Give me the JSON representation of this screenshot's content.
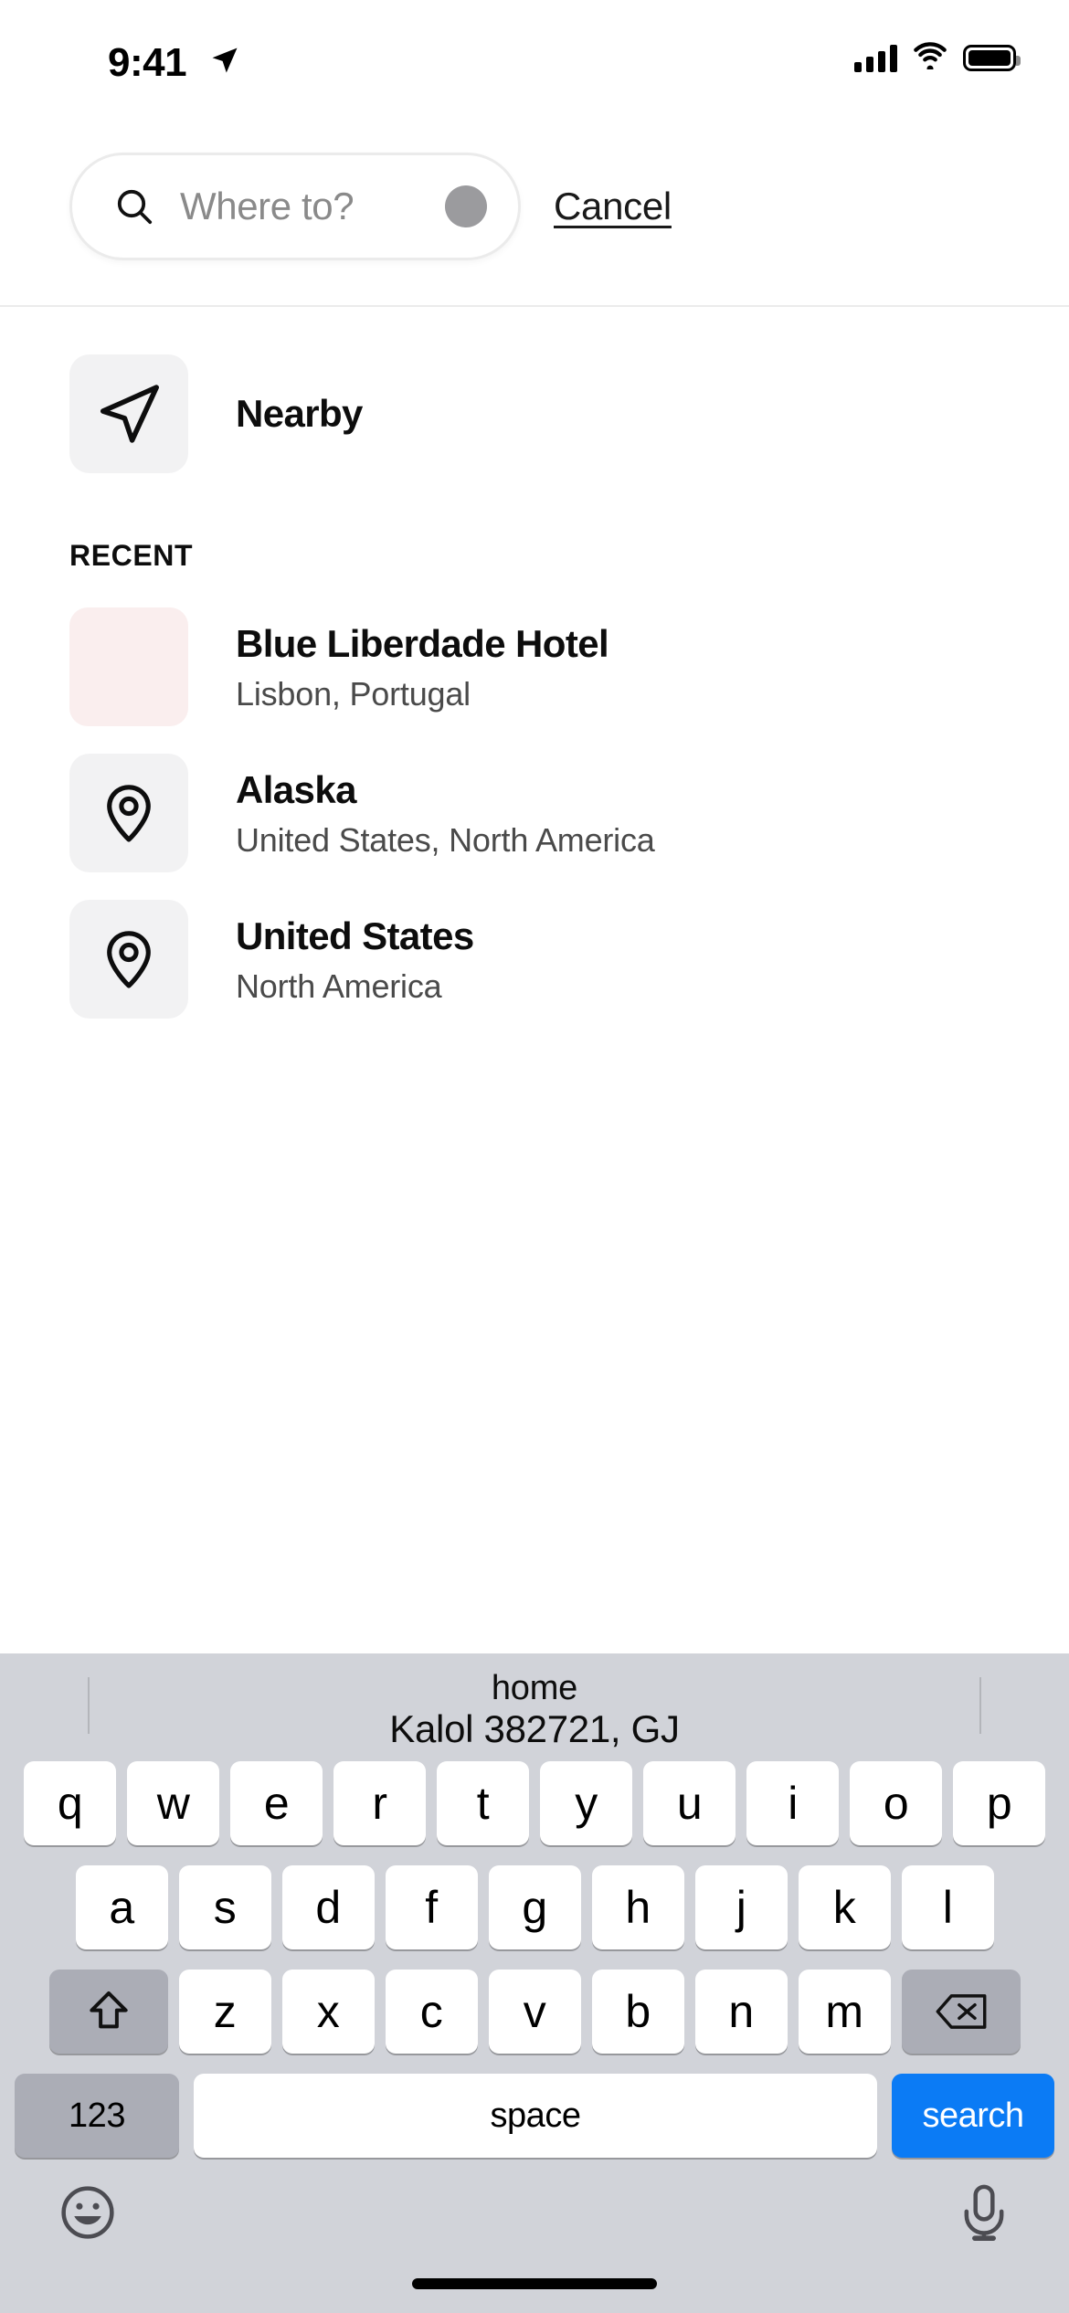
{
  "status_bar": {
    "time": "9:41",
    "location_arrow_icon": "location-arrow-icon",
    "signal_icon": "cellular-signal-icon",
    "wifi_icon": "wifi-icon",
    "battery_icon": "battery-full-icon"
  },
  "search": {
    "icon": "search-icon",
    "placeholder": "Where to?",
    "value": "",
    "clear_icon": "clear-dot-icon",
    "cancel_label": "Cancel"
  },
  "nearby": {
    "icon": "navigation-arrow-icon",
    "label": "Nearby"
  },
  "recent": {
    "section_label": "RECENT",
    "items": [
      {
        "icon": "thumbnail-photo",
        "title": "Blue Liberdade Hotel",
        "subtitle": "Lisbon, Portugal",
        "thumb_color": "#faeeee"
      },
      {
        "icon": "map-pin-icon",
        "title": "Alaska",
        "subtitle": "United States, North America",
        "thumb_color": "#f2f2f3"
      },
      {
        "icon": "map-pin-icon",
        "title": "United States",
        "subtitle": "North America",
        "thumb_color": "#f2f2f3"
      }
    ]
  },
  "keyboard": {
    "predictive": {
      "line1": "home",
      "line2": "Kalol 382721, GJ"
    },
    "row1": [
      "q",
      "w",
      "e",
      "r",
      "t",
      "y",
      "u",
      "i",
      "o",
      "p"
    ],
    "row2": [
      "a",
      "s",
      "d",
      "f",
      "g",
      "h",
      "j",
      "k",
      "l"
    ],
    "row3": [
      "z",
      "x",
      "c",
      "v",
      "b",
      "n",
      "m"
    ],
    "shift_icon": "shift-arrow-icon",
    "backspace_icon": "backspace-icon",
    "numeric_label": "123",
    "space_label": "space",
    "search_label": "search",
    "emoji_icon": "emoji-smiley-icon",
    "mic_icon": "microphone-icon",
    "accent_color": "#0b7bf5",
    "background_color": "#d1d3d9"
  }
}
